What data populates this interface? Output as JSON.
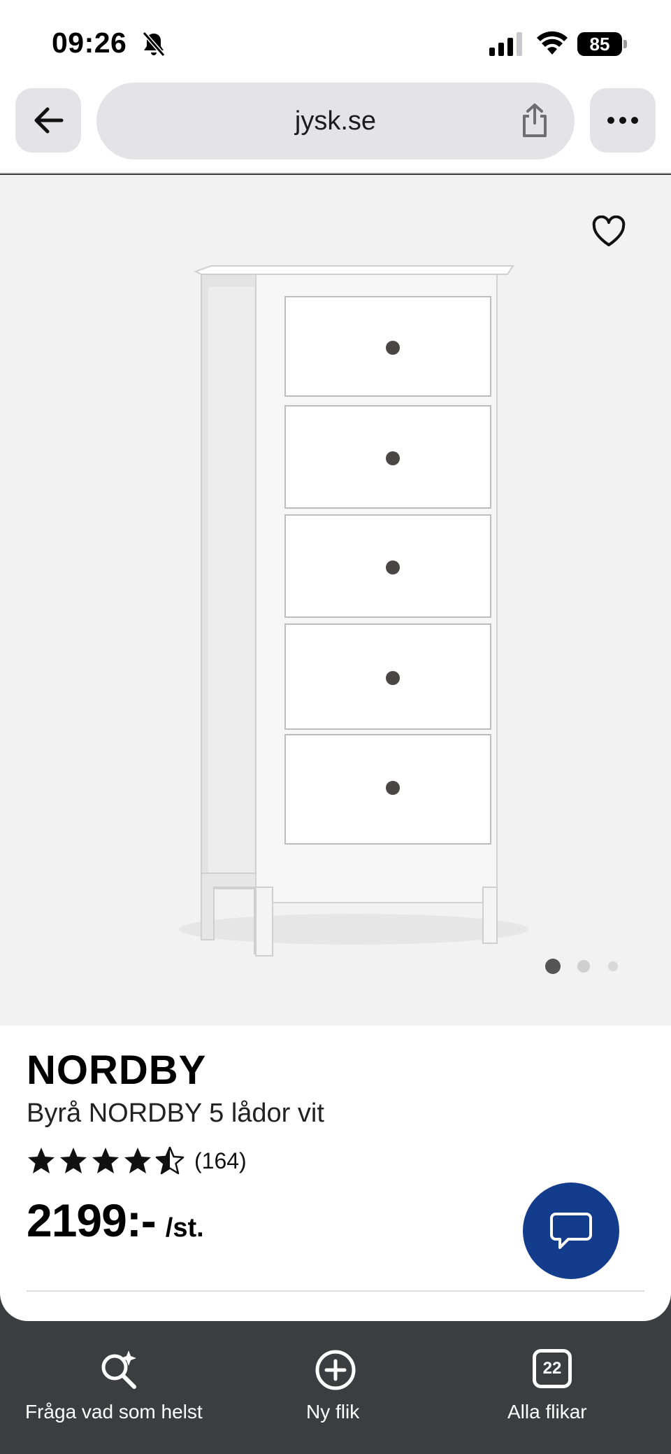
{
  "status_bar": {
    "time": "09:26",
    "battery": "85"
  },
  "browser": {
    "url": "jysk.se"
  },
  "product": {
    "brand": "NORDBY",
    "name": "Byrå NORDBY 5 lådor vit",
    "rating": 4.5,
    "review_count": "(164)",
    "price": "2199:-",
    "unit": "/st."
  },
  "gallery": {
    "image_count": 3,
    "active_index": 0
  },
  "toolbar": {
    "ask_label": "Fråga vad som helst",
    "new_tab_label": "Ny flik",
    "all_tabs_label": "Alla flikar",
    "tab_count": "22"
  },
  "colors": {
    "chat_button": "#143c8c",
    "toolbar_bg": "#3b3d41",
    "pill_bg": "#e4e4e8"
  }
}
